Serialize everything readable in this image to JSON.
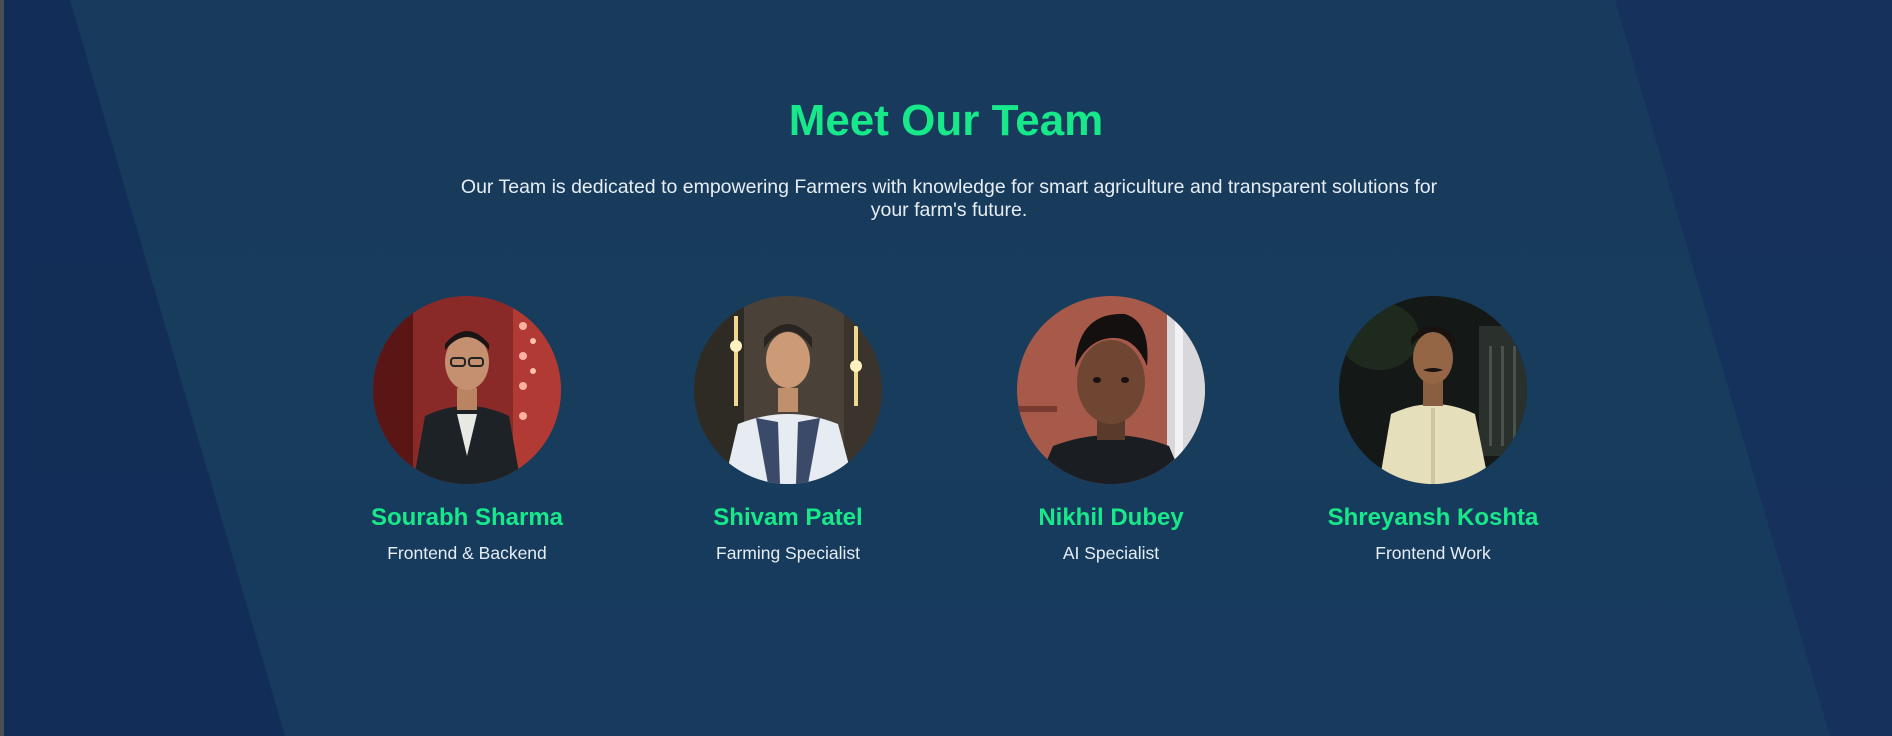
{
  "section": {
    "title": "Meet Our Team",
    "subtitle": "Our Team is dedicated to empowering Farmers with knowledge for smart agriculture and transparent solutions for your farm's future."
  },
  "team": [
    {
      "name": "Sourabh Sharma",
      "role": "Frontend & Backend",
      "photo": "portrait-photo"
    },
    {
      "name": "Shivam Patel",
      "role": "Farming Specialist",
      "photo": "portrait-photo"
    },
    {
      "name": "Nikhil Dubey",
      "role": "AI Specialist",
      "photo": "portrait-photo"
    },
    {
      "name": "Shreyansh Koshta",
      "role": "Frontend Work",
      "photo": "portrait-photo"
    }
  ],
  "colors": {
    "background": "#18365a",
    "accent": "#17e88a",
    "text": "#e6edf3"
  }
}
